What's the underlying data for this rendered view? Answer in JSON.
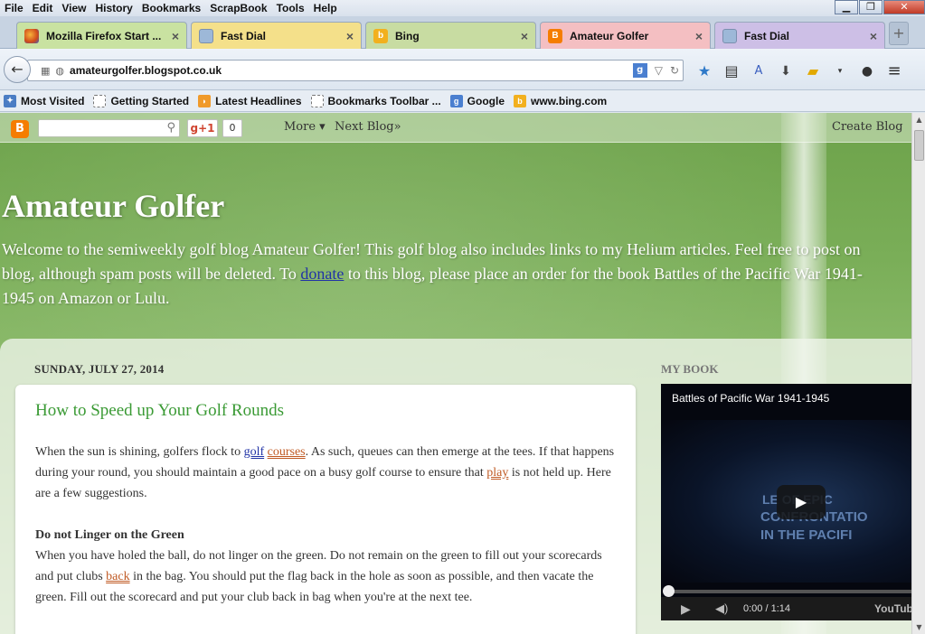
{
  "menu": [
    "File",
    "Edit",
    "View",
    "History",
    "Bookmarks",
    "ScrapBook",
    "Tools",
    "Help"
  ],
  "window_controls": {
    "minimize": "▁",
    "restore": "❐",
    "close": "✕"
  },
  "tabs": [
    {
      "label": "Mozilla Firefox Start ...",
      "icon": "firefox-icon",
      "color": "#c9e2a1"
    },
    {
      "label": "Fast Dial",
      "icon": "fastdial-icon",
      "color": "#f4e08a"
    },
    {
      "label": "Bing",
      "icon": "bing-icon",
      "color": "#c8dca2"
    },
    {
      "label": "Amateur Golfer",
      "icon": "blogger-icon",
      "color": "#f4bfc2"
    },
    {
      "label": "Fast Dial",
      "icon": "fastdial-icon",
      "color": "#cdbfe6"
    }
  ],
  "tab_close": "×",
  "new_tab": "+",
  "url": "amateurgolfer.blogspot.co.uk",
  "search_engine_letter": "g",
  "bookmarks": [
    {
      "label": "Most Visited",
      "icon": "most-visited-icon",
      "color": "#4b7dc4"
    },
    {
      "label": "Getting Started",
      "icon": "page-icon",
      "color": "#ffffff"
    },
    {
      "label": "Latest Headlines",
      "icon": "rss-icon",
      "color": "#f09a2a"
    },
    {
      "label": "Bookmarks Toolbar ...",
      "icon": "page-icon",
      "color": "#ffffff"
    },
    {
      "label": "Google",
      "icon": "google-icon",
      "color": "#4a7fd0"
    },
    {
      "label": "www.bing.com",
      "icon": "bing-icon",
      "color": "#f2b01e"
    }
  ],
  "blogger_nav": {
    "logo": "B",
    "gplus": "g+1",
    "gplus_count": "0",
    "more": "More ▾",
    "next_blog": "Next Blog»",
    "create_blog": "Create Blog"
  },
  "header": {
    "title": "Amateur Golfer",
    "desc_1": "Welcome to the semiweekly golf blog Amateur Golfer! This golf blog also includes links to my Helium articles. Feel free to post on",
    "desc_2a": "blog, although spam posts will be deleted. To ",
    "desc_link": "donate",
    "desc_2b": " to this blog, please place an order for the book Battles of the Pacific War 1941-",
    "desc_3": "1945 on Amazon or Lulu."
  },
  "post": {
    "date": "SUNDAY, JULY 27, 2014",
    "title": "How to Speed up Your Golf Rounds",
    "p1_a": "When the sun is shining, golfers flock to ",
    "p1_kw1": "golf",
    "p1_kw2": "courses",
    "p1_b": ". As such, queues can then emerge at the tees. If that happens during your round, you should maintain a good pace on a busy golf course to ensure that ",
    "p1_kw3": "play",
    "p1_c": " is not held up. Here are a few suggestions.",
    "h1": "Do not Linger on the Green",
    "p2_a": "When you have holed the ball, do not linger on the green. Do not remain on the green to fill out your scorecards and put clubs ",
    "p2_kw": "back",
    "p2_b": " in the bag. You should put the flag back in the hole as soon as possible, and then vacate the green. Fill out the scorecard and put your club back in bag when you're at the next tee."
  },
  "sidebar": {
    "heading": "MY BOOK",
    "video": {
      "title": "Battles of Pacific War 1941-1945",
      "overlay_1": "LE OF EPIC",
      "overlay_2": "CONFRONTATIO",
      "overlay_3": "IN THE PACIFI",
      "time": "0:00 / 1:14",
      "progress": 0,
      "youtube": "YouTube"
    }
  }
}
